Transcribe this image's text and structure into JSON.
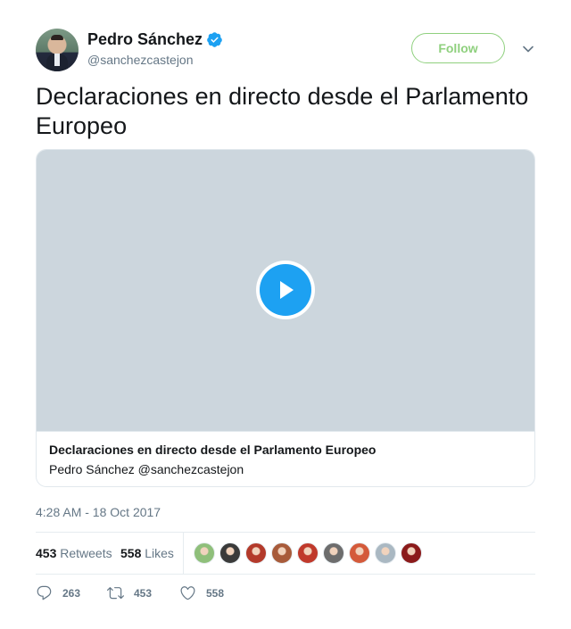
{
  "user": {
    "display_name": "Pedro Sánchez",
    "handle": "@sanchezcastejon",
    "verified_icon": "verified-badge-icon",
    "verified_color": "#1da1f2"
  },
  "follow": {
    "label": "Follow",
    "color": "#8fd07e"
  },
  "tweet": {
    "text": "Declaraciones en directo desde el Parlamento Europeo",
    "timestamp": "4:28 AM - 18 Oct 2017"
  },
  "card": {
    "title": "Declaraciones en directo desde el Parlamento Europeo",
    "subtitle": "Pedro Sánchez @sanchezcastejon",
    "play_icon": "play-icon",
    "play_color": "#1da1f2"
  },
  "stats": {
    "retweets_count": "453",
    "retweets_label": "Retweets",
    "likes_count": "558",
    "likes_label": "Likes",
    "likers": [
      {
        "color": "#8fbf7a"
      },
      {
        "color": "#3a3a3a"
      },
      {
        "color": "#b33a2a"
      },
      {
        "color": "#a85b3a"
      },
      {
        "color": "#c0392b"
      },
      {
        "color": "#6d6d6d"
      },
      {
        "color": "#d45a3a"
      },
      {
        "color": "#aab8c2"
      },
      {
        "color": "#8b1a1a"
      }
    ]
  },
  "actions": {
    "reply_count": "263",
    "retweet_count": "453",
    "like_count": "558"
  }
}
